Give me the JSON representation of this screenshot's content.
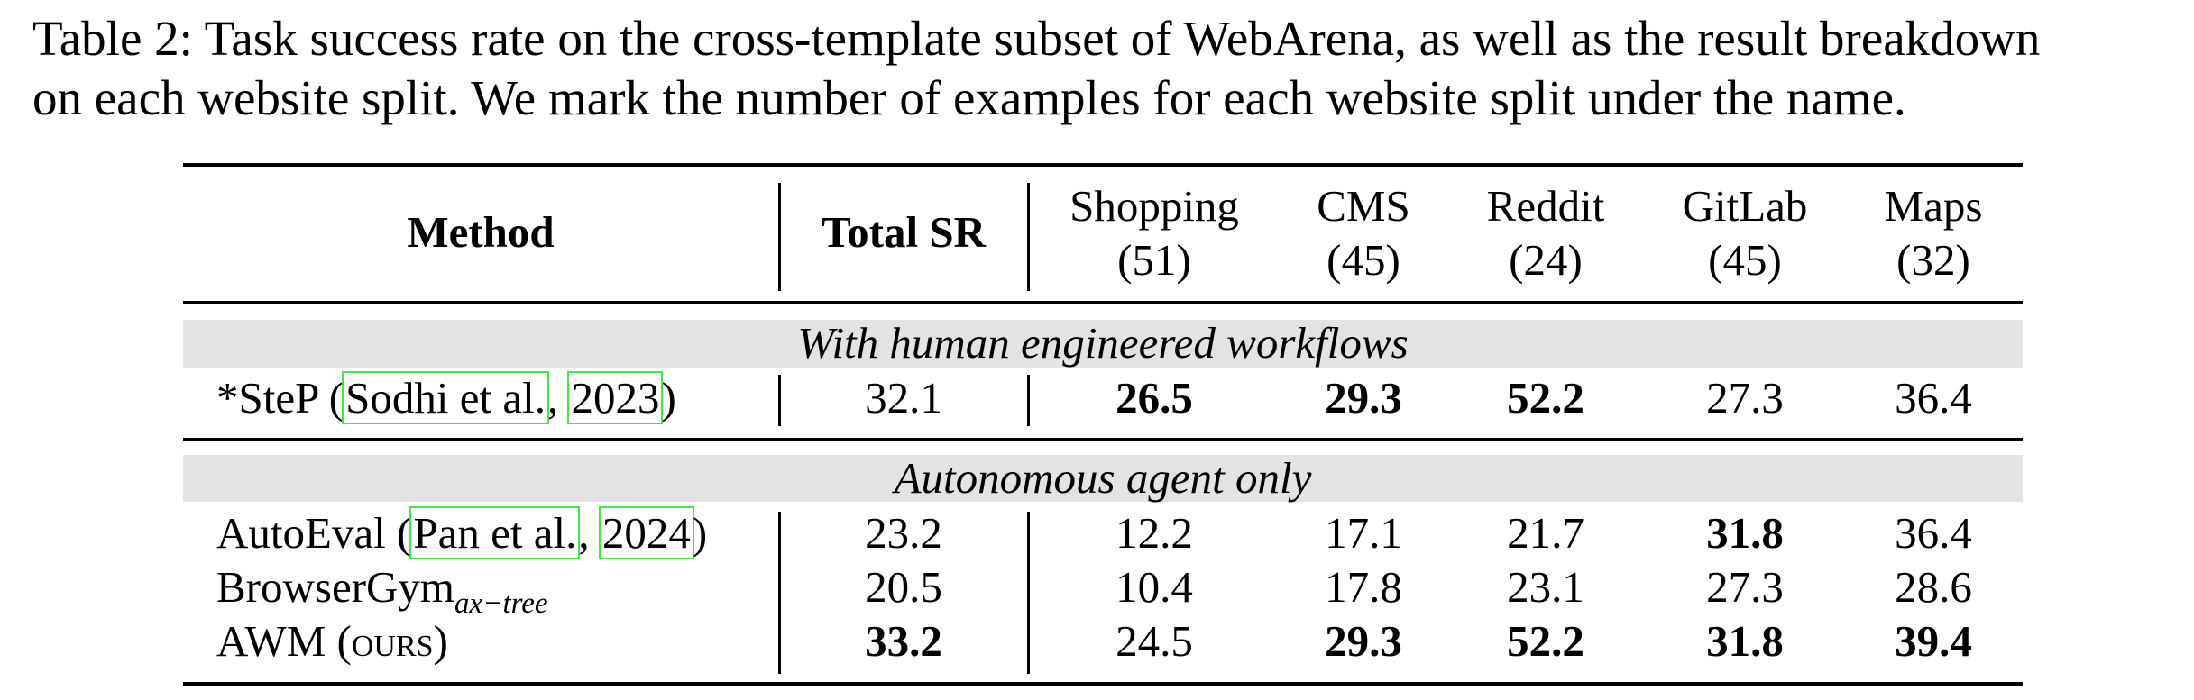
{
  "caption": {
    "line1": "Table 2: Task success rate on the cross-template subset of WebArena, as well as the result breakdown",
    "line2": "on each website split. We mark the number of examples for each website split under the name."
  },
  "header": {
    "method": "Method",
    "total": "Total SR",
    "splits": [
      {
        "name": "Shopping",
        "count": "(51)"
      },
      {
        "name": "CMS",
        "count": "(45)"
      },
      {
        "name": "Reddit",
        "count": "(24)"
      },
      {
        "name": "GitLab",
        "count": "(45)"
      },
      {
        "name": "Maps",
        "count": "(32)"
      }
    ]
  },
  "groups": [
    {
      "label": "With human engineered workflows",
      "rows": [
        {
          "method_prefix": "*SteP (",
          "cite_author": "Sodhi et al.",
          "cite_sep": ", ",
          "cite_year": "2023",
          "method_suffix": ")",
          "total": "32.1",
          "total_bold": false,
          "values": [
            "26.5",
            "29.3",
            "52.2",
            "27.3",
            "36.4"
          ],
          "bold": [
            true,
            true,
            true,
            false,
            false
          ]
        }
      ]
    },
    {
      "label": "Autonomous agent only",
      "rows": [
        {
          "method_prefix": "AutoEval (",
          "cite_author": "Pan et al.",
          "cite_sep": ", ",
          "cite_year": "2024",
          "method_suffix": ")",
          "total": "23.2",
          "total_bold": false,
          "values": [
            "12.2",
            "17.1",
            "21.7",
            "31.8",
            "36.4"
          ],
          "bold": [
            false,
            false,
            false,
            true,
            false
          ]
        },
        {
          "method_main": "BrowserGym",
          "method_sub": "ax−tree",
          "total": "20.5",
          "total_bold": false,
          "values": [
            "10.4",
            "17.8",
            "23.1",
            "27.3",
            "28.6"
          ],
          "bold": [
            false,
            false,
            false,
            false,
            false
          ]
        },
        {
          "method_main": "AWM (",
          "method_sc": "ours",
          "method_end": ")",
          "total": "33.2",
          "total_bold": true,
          "values": [
            "24.5",
            "29.3",
            "52.2",
            "31.8",
            "39.4"
          ],
          "bold": [
            false,
            true,
            true,
            true,
            true
          ]
        }
      ]
    }
  ]
}
